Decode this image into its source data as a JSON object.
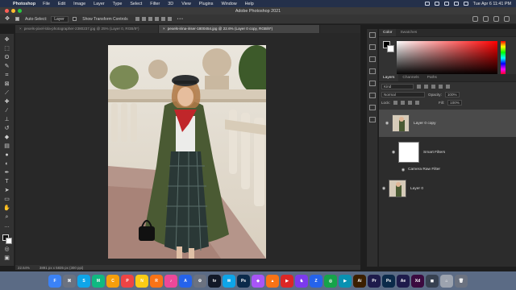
{
  "menubar": {
    "app_name": "Photoshop",
    "items": [
      "File",
      "Edit",
      "Image",
      "Layer",
      "Type",
      "Select",
      "Filter",
      "3D",
      "View",
      "Plugins",
      "Window",
      "Help"
    ],
    "clock": "Tue Apr 6  11:41 PM"
  },
  "window": {
    "title": "Adobe Photoshop 2021"
  },
  "options_bar": {
    "auto_select_label": "Auto-Select:",
    "auto_select_value": "Layer",
    "transform_label": "Show Transform Controls"
  },
  "doc_tabs": [
    {
      "label": "pexels-pixel-lola-photographer-2380237.jpg @ 25% (Layer 0, RGB/8*)",
      "active": false
    },
    {
      "label": "pexels-irina-iriser-1800454.jpg @ 22.6% (Layer 0 copy, RGB/8*)",
      "active": true
    }
  ],
  "status_bar": {
    "zoom": "22.64%",
    "doc_info": "3891 px x 5835 px (300 ppi)"
  },
  "color_panel": {
    "tabs": [
      "Color",
      "Swatches"
    ],
    "fg": "#000000",
    "bg": "#ffffff"
  },
  "layers_panel": {
    "tabs": [
      "Layers",
      "Channels",
      "Paths"
    ],
    "kind": "Kind",
    "blend_mode": "Normal",
    "opacity_label": "Opacity:",
    "opacity": "100%",
    "lock_label": "Lock:",
    "fill_label": "Fill:",
    "fill": "100%",
    "layers": [
      {
        "name": "Layer 0 copy",
        "type": "smart"
      },
      {
        "name": "Smart Filters",
        "type": "filters"
      },
      {
        "name": "Camera Raw Filter",
        "type": "filter"
      },
      {
        "name": "Layer 0",
        "type": "pixel"
      }
    ]
  },
  "dock": {
    "apps": [
      {
        "label": "F",
        "color": "#3b82f6"
      },
      {
        "label": "⌘",
        "color": "#6b7280"
      },
      {
        "label": "S",
        "color": "#0ea5e9"
      },
      {
        "label": "M",
        "color": "#10b981"
      },
      {
        "label": "C",
        "color": "#f59e0b"
      },
      {
        "label": "P",
        "color": "#ef4444"
      },
      {
        "label": "N",
        "color": "#facc15"
      },
      {
        "label": "R",
        "color": "#f97316"
      },
      {
        "label": "♪",
        "color": "#ec4899"
      },
      {
        "label": "A",
        "color": "#2563eb"
      },
      {
        "label": "⚙",
        "color": "#6b7280"
      },
      {
        "label": "tv",
        "color": "#111827"
      },
      {
        "label": "✉",
        "color": "#0ea5e9"
      },
      {
        "label": "Ps",
        "color": "#0b2a4a"
      },
      {
        "label": "◆",
        "color": "#a855f7"
      },
      {
        "label": "▲",
        "color": "#f97316"
      },
      {
        "label": "▶",
        "color": "#dc2626"
      },
      {
        "label": "♞",
        "color": "#7c3aed"
      },
      {
        "label": "Z",
        "color": "#2563eb"
      },
      {
        "label": "◎",
        "color": "#16a34a"
      },
      {
        "label": "▶",
        "color": "#0891b2"
      },
      {
        "label": "Ai",
        "color": "#3b1f00"
      },
      {
        "label": "Pr",
        "color": "#1e1b4b"
      },
      {
        "label": "Ps",
        "color": "#0b2a4a"
      },
      {
        "label": "Ae",
        "color": "#1e1b4b"
      },
      {
        "label": "Xd",
        "color": "#3b0a3f"
      },
      {
        "label": "◼",
        "color": "#374151"
      },
      {
        "label": "⌂",
        "color": "#9ca3af"
      },
      {
        "label": "🗑",
        "color": "#6b7280"
      }
    ]
  }
}
